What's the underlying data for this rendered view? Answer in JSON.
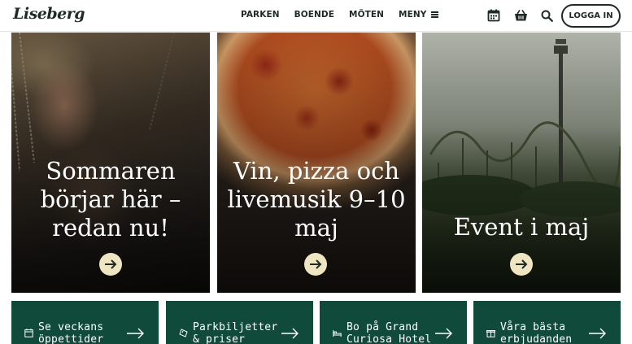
{
  "brand": {
    "logo_text": "Liseberg"
  },
  "nav": {
    "items": [
      {
        "label": "PARKEN"
      },
      {
        "label": "BOENDE"
      },
      {
        "label": "MÖTEN"
      },
      {
        "label": "MENY"
      }
    ],
    "login_label": "LOGGA IN",
    "icons": [
      "calendar-icon",
      "basket-icon",
      "search-icon",
      "menu-icon"
    ]
  },
  "cards": [
    {
      "title": "Sommaren börjar här – redan nu!",
      "icon": "arrow-right-icon"
    },
    {
      "title": "Vin, pizza och livemusik 9–10 maj",
      "icon": "arrow-right-icon"
    },
    {
      "title": "Event i maj",
      "icon": "arrow-right-icon"
    }
  ],
  "quick_links": [
    {
      "label": "Se veckans öppettider",
      "icon": "calendar-icon"
    },
    {
      "label": "Parkbiljetter & priser",
      "icon": "ticket-icon"
    },
    {
      "label": "Bo på Grand Curiosa Hotel",
      "icon": "bed-icon"
    },
    {
      "label": "Våra bästa erbjudanden",
      "icon": "gift-icon"
    }
  ],
  "colors": {
    "header_text": "#1e2a24",
    "quick_link_bg": "#0f4a3a",
    "arrow_button_bg": "#efe6c1"
  }
}
